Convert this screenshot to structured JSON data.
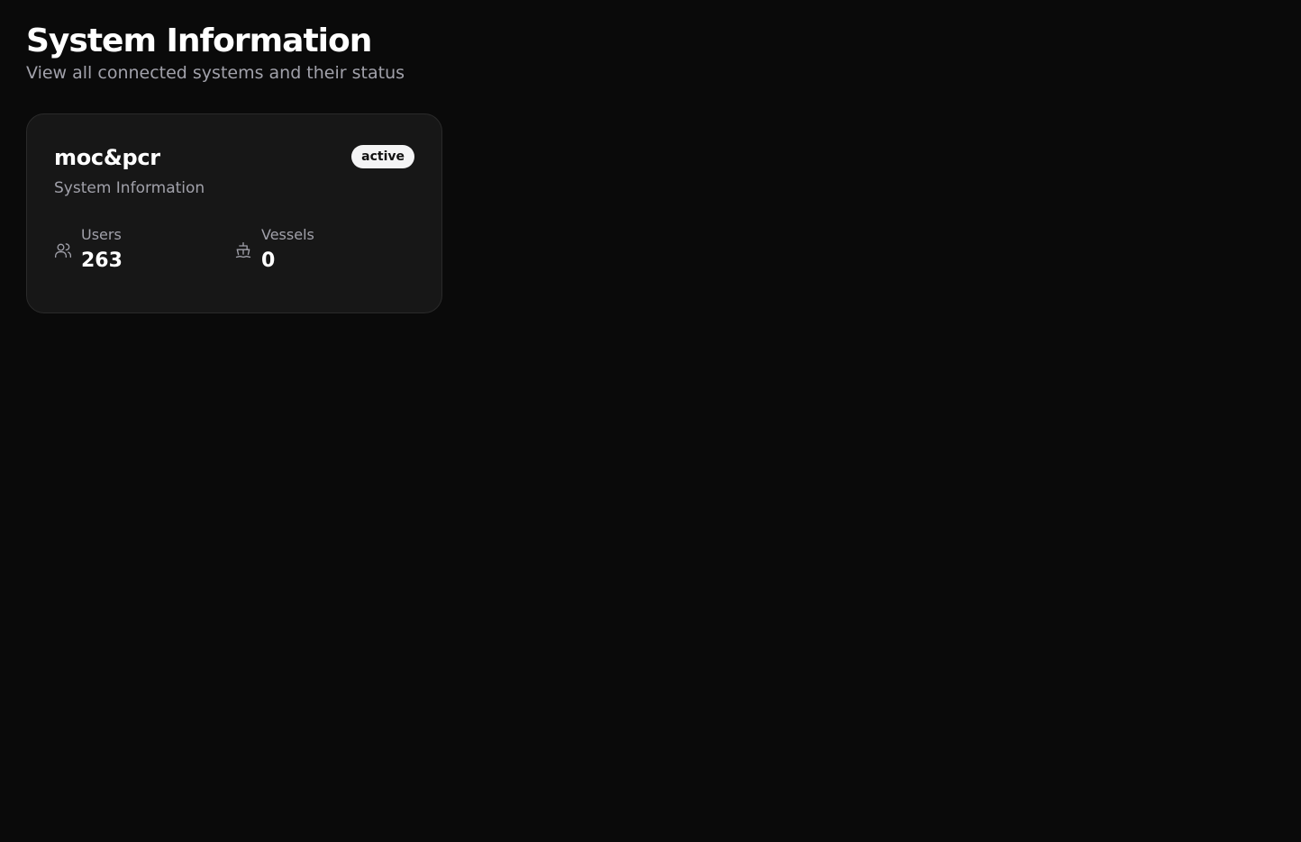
{
  "header": {
    "title": "System Information",
    "subtitle": "View all connected systems and their status"
  },
  "systems": [
    {
      "name": "moc&pcr",
      "status": "active",
      "description": "System Information",
      "stats": [
        {
          "label": "Users",
          "value": "263",
          "icon": "users-icon"
        },
        {
          "label": "Vessels",
          "value": "0",
          "icon": "ship-icon"
        }
      ]
    }
  ],
  "colors": {
    "background": "#0a0a0a",
    "card": "#171717",
    "badge_bg": "#f4f4f5",
    "muted_text": "#a1a1aa"
  }
}
